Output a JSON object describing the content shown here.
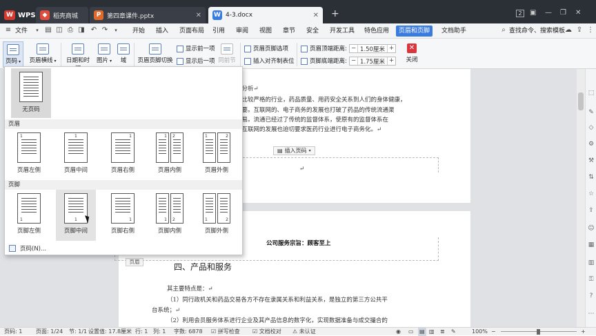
{
  "titlebar": {
    "app": "WPS",
    "tabs": [
      {
        "label": "稻壳商城"
      },
      {
        "label": "第四章课件.pptx"
      },
      {
        "label": "4-3.docx"
      }
    ],
    "new_tab": "+",
    "badge": "2",
    "user": "纯之风"
  },
  "menubar": {
    "file": "文件",
    "items": [
      "开始",
      "插入",
      "页面布局",
      "引用",
      "审阅",
      "视图",
      "章节",
      "安全",
      "开发工具",
      "特色应用",
      "页眉和页脚",
      "文档助手"
    ],
    "search": "查找命令、搜索模板"
  },
  "ribbon": {
    "page_num": "页码",
    "header_footer_horizontal": "页眉横线",
    "date_time": "日期和时间",
    "picture": "图片",
    "field": "域",
    "switch": "页眉页脚切换",
    "show_prev": "显示前一项",
    "show_next": "显示后一项",
    "same_prev": "同前节",
    "options": "页眉页脚选项",
    "insert_tab": "插入对齐制表位",
    "top_dist_label": "页眉顶端距离:",
    "top_dist_value": "1.50厘米",
    "bottom_dist_label": "页脚底端距离:",
    "bottom_dist_value": "1.75厘米",
    "close": "关闭"
  },
  "dropdown": {
    "none": "无页码",
    "header_section": "页眉",
    "header_items": [
      "页眉左侧",
      "页眉中间",
      "页眉右侧",
      "页眉内侧",
      "页眉外侧"
    ],
    "footer_section": "页脚",
    "footer_items": [
      "页脚左侧",
      "页脚中间",
      "页脚右侧",
      "页脚内侧",
      "页脚外侧"
    ],
    "more": "页码(N)..."
  },
  "document": {
    "line1": "状分析↵",
    "line2": "于比较严格的行业，药品质量、用药安全关系到人们的身体健康，",
    "line3": "重要。互联网的、电子商务的发展也打破了药品的传统流通渠",
    "line4": "交易。流通已经过了传统的监督体系，使原有的监督体系在",
    "line5": "以互联网的发展也迫切要求医药行业进行电子商务化。↵",
    "insert_page_num": "插入页码",
    "footer_mark": "↵",
    "header_text": "公司服务宗旨：顾客至上",
    "header_tag": "页眉",
    "heading": "四、产品和服务",
    "p1": "其主要特点是：↵",
    "p2": "（1）同行政机关和药品交易各方不存在隶属关系和利益关系，是独立的第三方公共平",
    "p3": "台系统；↵",
    "p4": "（2）利用会员服务体系进行企业及其产品信息的数字化，实现数据准备与成交撮合的"
  },
  "statusbar": {
    "page": "页码: 1",
    "pages": "页面: 1/24",
    "section": "节: 1/1",
    "setting": "设置值: 17.8厘米",
    "row": "行: 1",
    "col": "列: 1",
    "words": "字数: 6878",
    "spell": "拼写检查",
    "proof": "文档校对",
    "auth": "未认证",
    "zoom": "100%"
  }
}
